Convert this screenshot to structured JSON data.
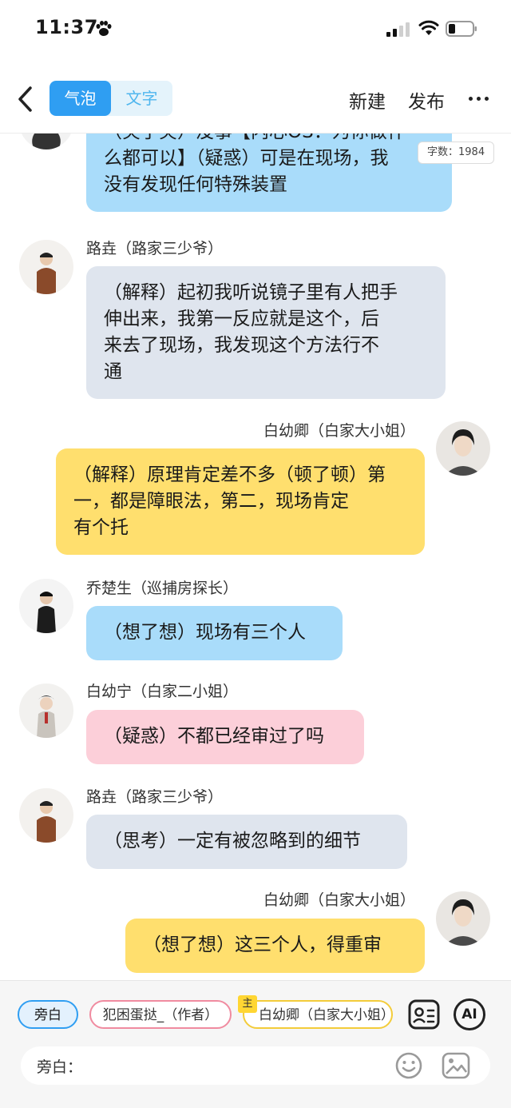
{
  "status_bar": {
    "time": "11:37"
  },
  "nav": {
    "tabs": [
      {
        "label": "气泡",
        "active": true
      },
      {
        "label": "文字",
        "active": false
      }
    ],
    "new_label": "新建",
    "publish_label": "发布"
  },
  "word_count": "字数：1984",
  "messages": [
    {
      "speaker": "",
      "text_lines": [
        "（笑了笑）没事【内心OS：为你做什",
        "么都可以】（疑惑）可是在现场，我",
        "没有发现任何特殊装置"
      ]
    },
    {
      "speaker": "路垚（路家三少爷）",
      "text_lines": [
        "（解释）起初我听说镜子里有人把手",
        "伸出来，我第一反应就是这个，后",
        "来去了现场，我发现这个方法行不",
        "通"
      ]
    },
    {
      "speaker": "白幼卿（白家大小姐）",
      "text_lines": [
        "（解释）原理肯定差不多（顿了顿）第",
        "一，都是障眼法，第二，现场肯定",
        "有个托"
      ]
    },
    {
      "speaker": "乔楚生（巡捕房探长）",
      "text_lines": [
        "（想了想）现场有三个人"
      ]
    },
    {
      "speaker": "白幼宁（白家二小姐）",
      "text_lines": [
        "（疑惑）不都已经审过了吗"
      ]
    },
    {
      "speaker": "路垚（路家三少爷）",
      "text_lines": [
        "（思考）一定有被忽略到的细节"
      ]
    },
    {
      "speaker": "白幼卿（白家大小姐）",
      "text_lines": [
        "（想了想）这三个人，得重审"
      ]
    }
  ],
  "role_chips": [
    {
      "label": "旁白",
      "selected": true
    },
    {
      "label": "犯困蛋挞_（作者）",
      "selected": false
    },
    {
      "label": "白幼卿（白家大小姐）",
      "selected": false,
      "tag": "主"
    }
  ],
  "composer": {
    "label": "旁白：",
    "placeholder": ""
  },
  "ai_label": "AI",
  "colors": {
    "accent": "#2f9ef2",
    "bubble_blue": "#a9dcfa",
    "bubble_gray": "#dfe5ee",
    "bubble_yellow": "#ffdf6e",
    "bubble_pink": "#fccfd9"
  },
  "icons": [
    "paw-icon",
    "signal-icon",
    "wifi-icon",
    "battery-icon",
    "back-icon",
    "more-icon",
    "role-card-icon",
    "ai-icon",
    "emoji-icon",
    "image-icon"
  ]
}
